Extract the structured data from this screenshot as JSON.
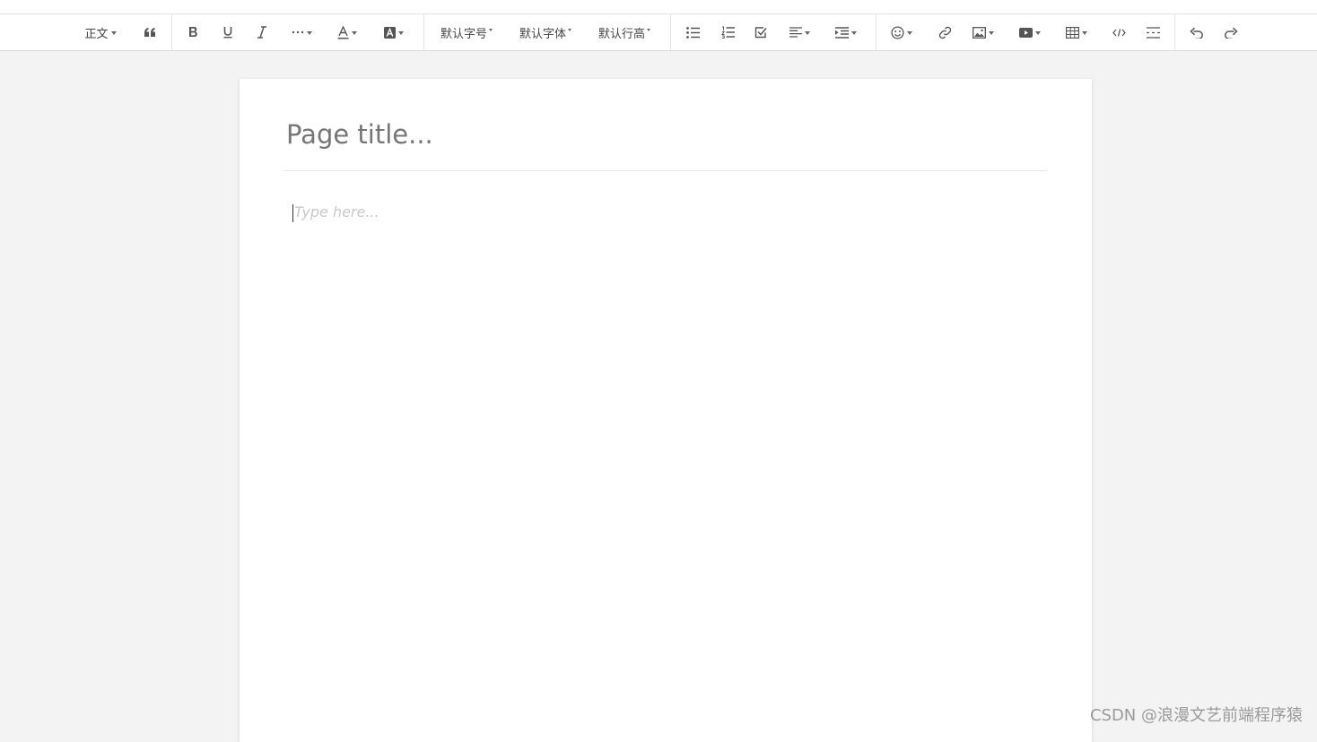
{
  "toolbar": {
    "paragraph_label": "正文",
    "font_size_label": "默认字号",
    "font_family_label": "默认字体",
    "line_height_label": "默认行高",
    "icons": [
      "quote-icon",
      "bold-icon",
      "underline-icon",
      "italic-icon",
      "more-icon",
      "font-color-icon",
      "background-color-icon",
      "bulleted-list-icon",
      "numbered-list-icon",
      "todo-icon",
      "align-icon",
      "indent-icon",
      "emoji-icon",
      "link-icon",
      "image-icon",
      "video-icon",
      "table-icon",
      "code-icon",
      "divider-icon",
      "undo-icon",
      "redo-icon"
    ]
  },
  "editor": {
    "title_placeholder": "Page title...",
    "body_placeholder": "Type here..."
  },
  "watermark": "CSDN @浪漫文艺前端程序猿",
  "colors": {
    "background": "#f3f3f3",
    "page": "#ffffff",
    "icon": "#555555"
  }
}
